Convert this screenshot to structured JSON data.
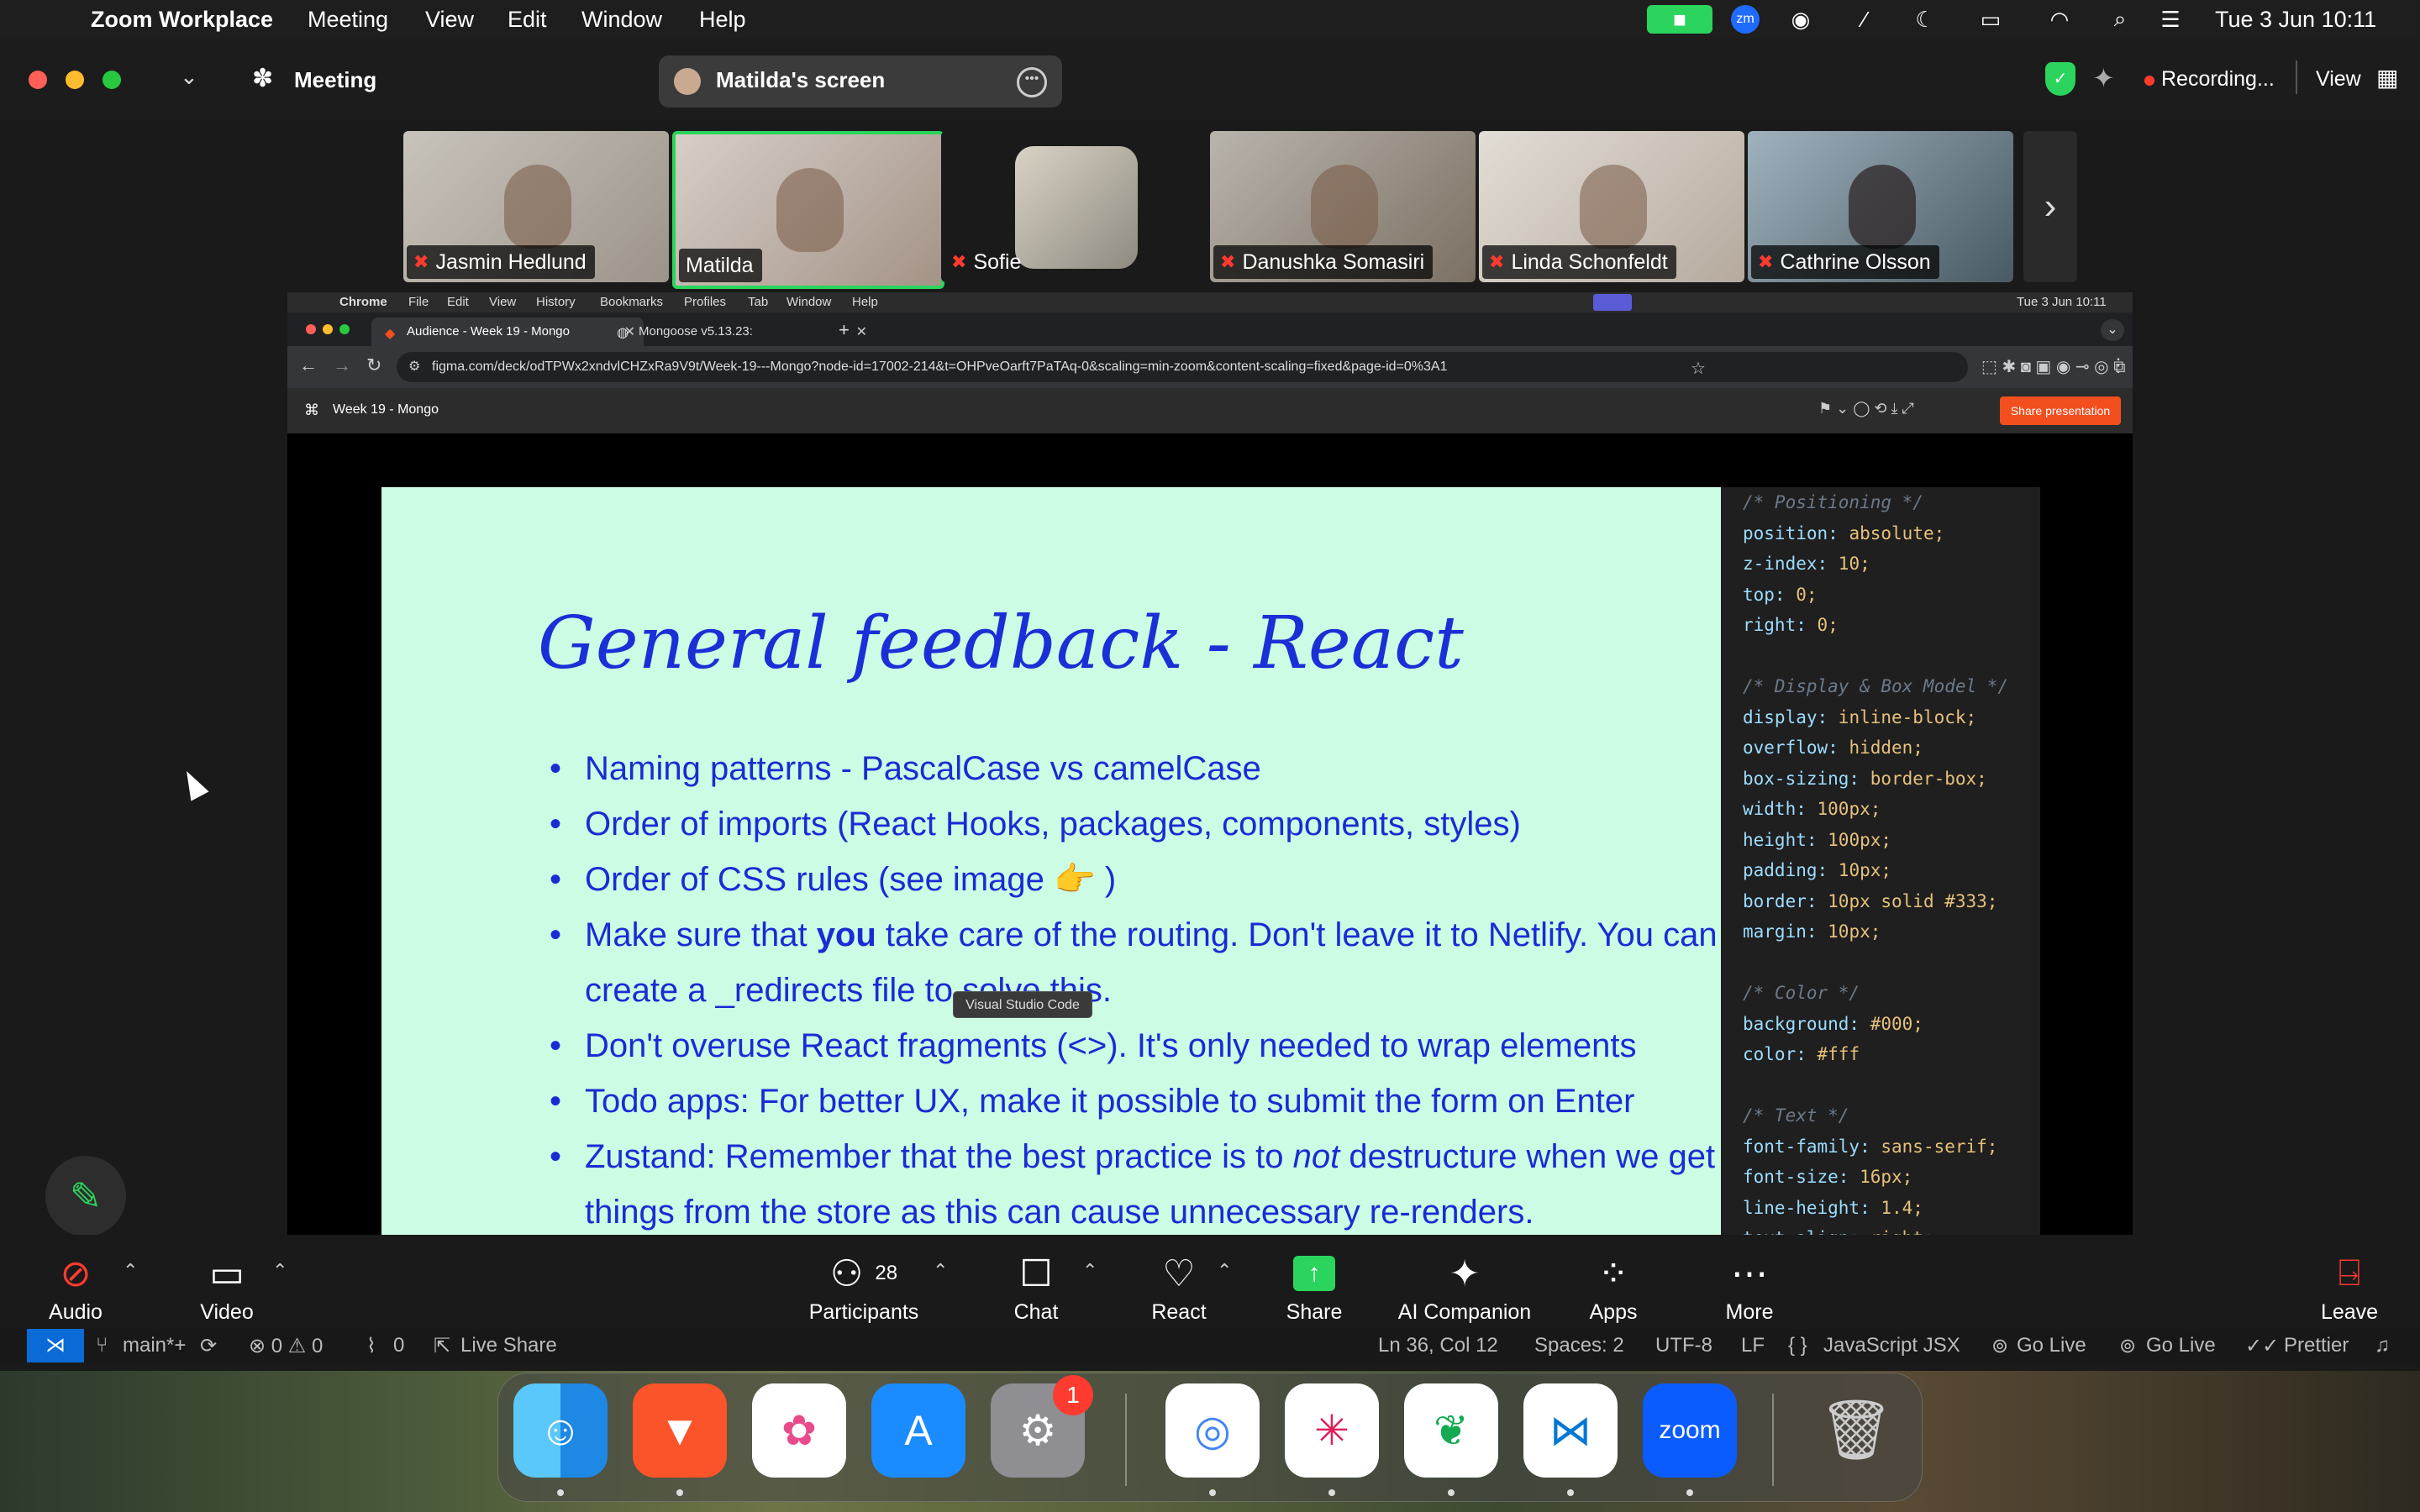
{
  "menubar": {
    "app_name": "Zoom Workplace",
    "menus": [
      "Meeting",
      "View",
      "Edit",
      "Window",
      "Help"
    ],
    "clock": "Tue 3 Jun  10:11"
  },
  "zoom": {
    "title": "Meeting",
    "share_label": "Matilda's screen",
    "recording": "Recording...",
    "view_label": "View",
    "participants": [
      {
        "name": "Jasmin Hedlund"
      },
      {
        "name": "Matilda"
      },
      {
        "name": "Sofie"
      },
      {
        "name": "Danushka Somasiri"
      },
      {
        "name": "Linda Schonfeldt"
      },
      {
        "name": "Cathrine Olsson"
      }
    ]
  },
  "chrome": {
    "app": "Chrome",
    "menus": [
      "File",
      "Edit",
      "View",
      "History",
      "Bookmarks",
      "Profiles",
      "Tab",
      "Window",
      "Help"
    ],
    "clock": "Tue 3 Jun  10:11",
    "tabs": [
      {
        "label": "Audience - Week 19 - Mongo"
      },
      {
        "label": "Mongoose v5.13.23:"
      }
    ],
    "url": "figma.com/deck/odTPWx2xndvlCHZxRa9V9t/Week-19---Mongo?node-id=17002-214&t=OHPveOarft7PaTAq-0&scaling=min-zoom&content-scaling=fixed&page-id=0%3A1",
    "figma_file": "Week 19 - Mongo",
    "share_presentation": "Share presentation"
  },
  "slide": {
    "title": "General feedback - React",
    "bullets": [
      "Naming patterns - PascalCase vs camelCase",
      "Order of imports (React Hooks, packages, components, styles)",
      "Order of CSS rules (see image 👉 )",
      "Make sure that you take care of the routing. Don't leave it to Netlify. You can create a _redirects file to solve this.",
      "Don't overuse React fragments (<>). It's only needed to wrap elements",
      "Todo apps: For better UX, make it possible to submit the form on Enter",
      "Zustand: Remember that the best practice is to not destructure when we get things from the store as this can cause unnecessary re-renders."
    ],
    "bullet3_pre": "Make sure that ",
    "bullet3_bold": "you",
    "bullet3_post": " take care of the routing. Don't leave it to Netlify. You can create a _redirects file to solve this.",
    "bullet6_pre": "Zustand: Remember that the best practice is to ",
    "bullet6_italic": "not",
    "bullet6_post": " destructure when we get things from the store as this can cause unnecessary re-renders."
  },
  "code_lines": [
    {
      "t": "cm",
      "text": "/* Positioning */"
    },
    {
      "t": "kv",
      "prop": "position",
      "val": "absolute;"
    },
    {
      "t": "kv",
      "prop": "z-index",
      "val": "10;"
    },
    {
      "t": "kv",
      "prop": "top",
      "val": "0;"
    },
    {
      "t": "kv",
      "prop": "right",
      "val": "0;"
    },
    {
      "t": "blank",
      "text": ""
    },
    {
      "t": "cm",
      "text": "/* Display & Box Model */"
    },
    {
      "t": "kv",
      "prop": "display",
      "val": "inline-block;"
    },
    {
      "t": "kv",
      "prop": "overflow",
      "val": "hidden;"
    },
    {
      "t": "kv",
      "prop": "box-sizing",
      "val": "border-box;"
    },
    {
      "t": "kv",
      "prop": "width",
      "val": "100px;"
    },
    {
      "t": "kv",
      "prop": "height",
      "val": "100px;"
    },
    {
      "t": "kv",
      "prop": "padding",
      "val": "10px;"
    },
    {
      "t": "kv",
      "prop": "border",
      "val": "10px solid #333;"
    },
    {
      "t": "kv",
      "prop": "margin",
      "val": "10px;"
    },
    {
      "t": "blank",
      "text": ""
    },
    {
      "t": "cm",
      "text": "/* Color */"
    },
    {
      "t": "kv",
      "prop": "background",
      "val": "#000;"
    },
    {
      "t": "kv",
      "prop": "color",
      "val": "#fff"
    },
    {
      "t": "blank",
      "text": ""
    },
    {
      "t": "cm",
      "text": "/* Text */"
    },
    {
      "t": "kv",
      "prop": "font-family",
      "val": "sans-serif;"
    },
    {
      "t": "kv",
      "prop": "font-size",
      "val": "16px;"
    },
    {
      "t": "kv",
      "prop": "line-height",
      "val": "1.4;"
    },
    {
      "t": "kv",
      "prop": "text-align",
      "val": "right;"
    }
  ],
  "tooltip": "Visual Studio Code",
  "toolbar": {
    "audio": "Audio",
    "video": "Video",
    "participants": "Participants",
    "participant_count": "28",
    "chat": "Chat",
    "react": "React",
    "share": "Share",
    "ai": "AI Companion",
    "apps": "Apps",
    "more": "More",
    "leave": "Leave"
  },
  "statusbar": {
    "branch": "main*+",
    "problems": "⊗ 0 ⚠ 0",
    "ports": "0",
    "live_share": "Live Share",
    "position": "Ln 36, Col 12",
    "spaces": "Spaces: 2",
    "encoding": "UTF-8",
    "eol": "LF",
    "language": "JavaScript JSX",
    "golive1": "Go Live",
    "golive2": "Go Live",
    "prettier": "Prettier"
  },
  "dock": {
    "zoom_label": "zoom",
    "settings_badge": "1"
  },
  "colors": {
    "slide_bg": "#ccfce4",
    "slide_text": "#1b2bd4",
    "active_speaker": "#2bd45c",
    "recording_dot": "#ff3b30",
    "share_green": "#2bd45c",
    "figma_orange": "#f24e1e"
  }
}
